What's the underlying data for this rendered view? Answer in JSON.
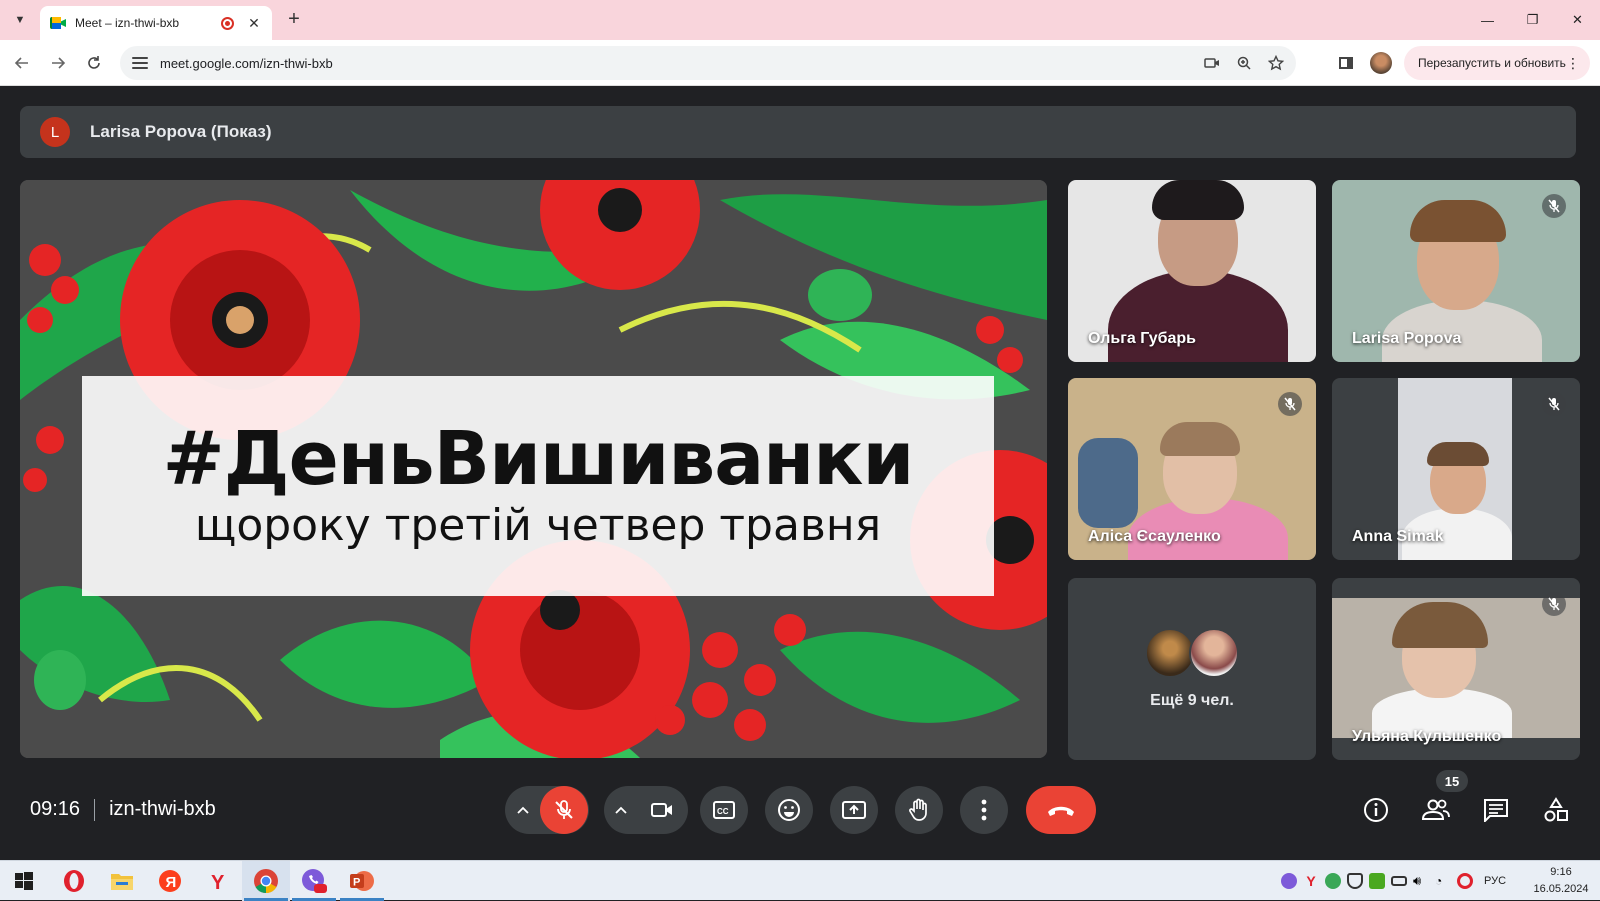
{
  "browser": {
    "tab_title": "Meet – izn-thwi-bxb",
    "tab_close": "✕",
    "new_tab": "+",
    "url": "meet.google.com/izn-thwi-bxb",
    "relaunch_label": "Перезапустить и обновить",
    "window_controls": [
      "—",
      "❐",
      "✕"
    ]
  },
  "presenter": {
    "initial": "L",
    "label": "Larisa Popova (Показ)"
  },
  "shared_screen": {
    "title": "#ДеньВишиванки",
    "subtitle": "щороку третій четвер травня"
  },
  "participants": [
    {
      "name": "Ольга Губарь",
      "muted": false
    },
    {
      "name": "Larisa Popova",
      "muted": true
    },
    {
      "name": "Аліса Єсауленко",
      "muted": true
    },
    {
      "name": "Anna Simak",
      "muted": true
    },
    {
      "name": "Ульяна Кульшенко",
      "muted": true
    }
  ],
  "more_people": "Ещё 9 чел.",
  "meeting": {
    "time": "09:16",
    "code": "izn-thwi-bxb",
    "participant_count": "15"
  },
  "taskbar": {
    "lang": "РУС",
    "time": "9:16",
    "date": "16.05.2024"
  },
  "colors": {
    "meet_bg": "#202124",
    "tile_bg": "#3c4043",
    "danger": "#ea4335",
    "tab_strip": "#f9d5dc"
  }
}
